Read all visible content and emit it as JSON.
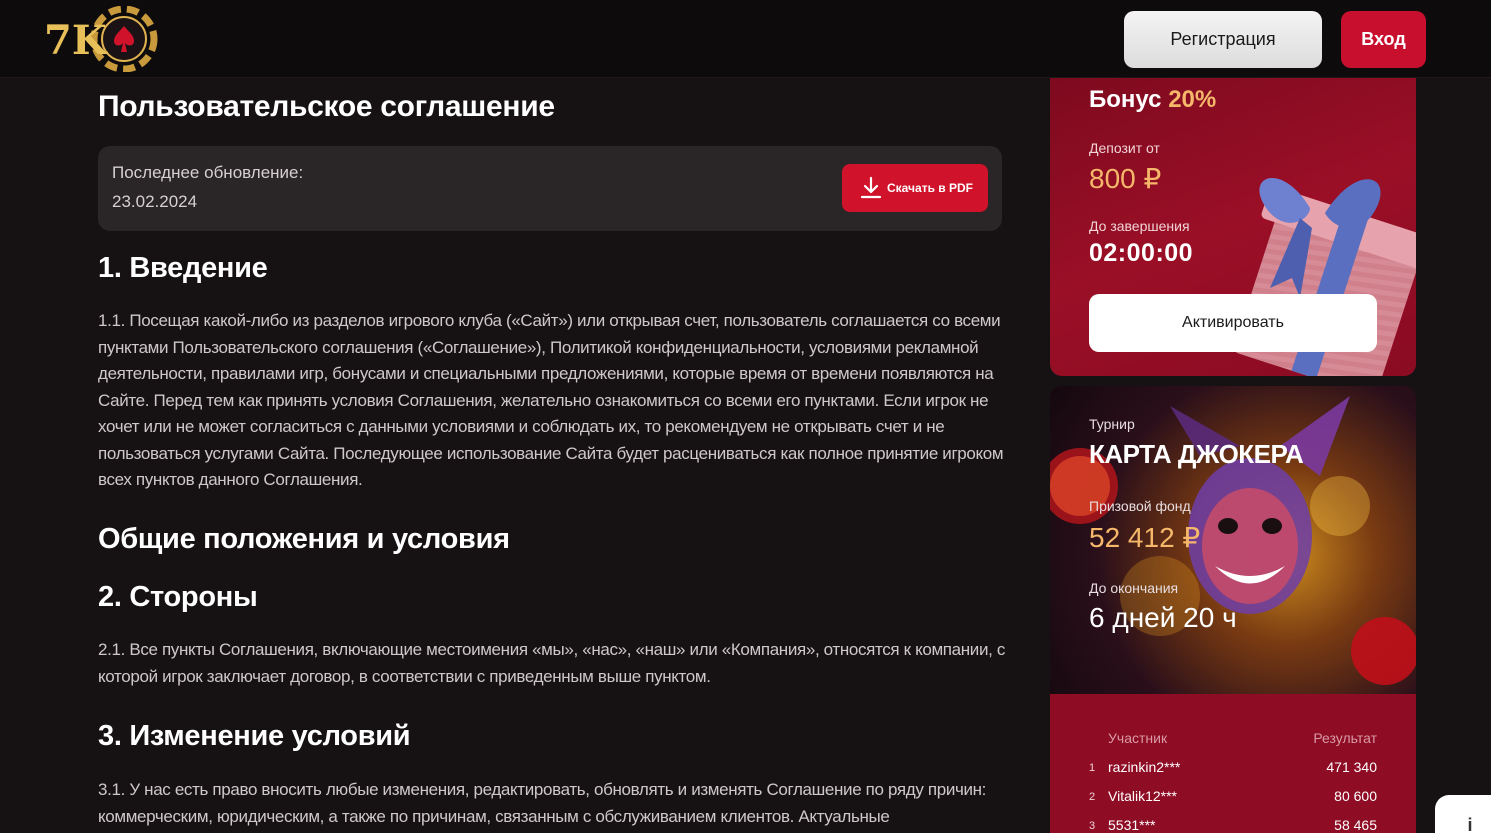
{
  "header": {
    "logo_text": "7K",
    "register_label": "Регистрация",
    "login_label": "Вход"
  },
  "main": {
    "title": "Пользовательское соглашение",
    "update": {
      "label": "Последнее обновление:",
      "date": "23.02.2024",
      "pdf_button": "Скачать в PDF"
    },
    "sections": [
      {
        "heading": "1. Введение",
        "text": "1.1. Посещая какой-либо из разделов игрового клуба («Сайт») или открывая счет, пользователь соглашается со всеми пунктами Пользовательского соглашения («Соглашение»), Политикой конфиденциальности, условиями рекламной деятельности, правилами игр, бонусами и специальными предложениями, которые время от времени появляются на Сайте. Перед тем как принять условия Соглашения, желательно ознакомиться со всеми его пунктами. Если игрок не хочет или не может согласиться с данными условиями и соблюдать их, то рекомендуем не открывать счет и не пользоваться услугами Сайта. Последующее использование Сайта будет расцениваться как полное принятие игроком всех пунктов данного Соглашения."
      },
      {
        "heading": "Общие положения и условия",
        "text": ""
      },
      {
        "heading": "2. Стороны",
        "text": "2.1. Все пункты Соглашения, включающие местоимения «мы», «нас», «наш» или «Компания», относятся к компании, с которой игрок заключает договор, в соответствии с приведенным выше пунктом."
      },
      {
        "heading": "3. Изменение условий",
        "text": "3.1. У нас есть право вносить любые изменения, редактировать, обновлять и изменять Соглашение по ряду причин: коммерческим, юридическим, а также по причинам, связанным с обслуживанием клиентов. Актуальные"
      }
    ]
  },
  "bonus": {
    "title": "Бонус",
    "percent": "20%",
    "deposit_label": "Депозит от",
    "deposit_value": "800 ₽",
    "until_label": "До завершения",
    "until_value": "02:00:00",
    "activate_label": "Активировать"
  },
  "tournament": {
    "label": "Турнир",
    "title": "КАРТА ДЖОКЕРА",
    "prize_label": "Призовой фонд",
    "prize_value": "52 412 ₽",
    "ends_label": "До окончания",
    "ends_value": "6 дней 20 ч"
  },
  "leaderboard": {
    "col_player": "Участник",
    "col_result": "Результат",
    "rows": [
      {
        "rank": "1",
        "name": "razinkin2***",
        "score": "471 340"
      },
      {
        "rank": "2",
        "name": "Vitalik12***",
        "score": "80 600"
      },
      {
        "rank": "3",
        "name": "5531***",
        "score": "58 465"
      }
    ]
  },
  "help": {
    "label": "i"
  },
  "colors": {
    "accent_red": "#c8102e",
    "gold": "#f5b86a",
    "background": "#161214"
  }
}
